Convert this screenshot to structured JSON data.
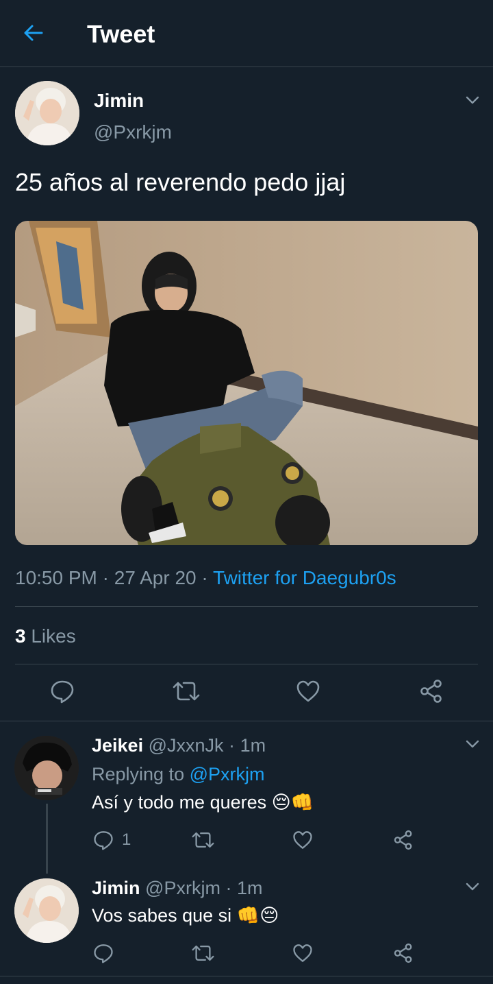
{
  "header": {
    "title": "Tweet"
  },
  "tweet": {
    "author_name": "Jimin",
    "author_handle": "@Pxrkjm",
    "text": "25 años al reverendo pedo jjaj",
    "time": "10:50 PM",
    "sep1": "·",
    "date": "27 Apr 20",
    "sep2": "·",
    "source": "Twitter for Daegubr0s",
    "likes_count": "3",
    "likes_label": "Likes"
  },
  "replies": [
    {
      "author_name": "Jeikei",
      "author_handle": "@JxxnJk",
      "dot": "·",
      "time": "1m",
      "replying_prefix": "Replying to",
      "replying_handle": "@Pxrkjm",
      "text": "Así y todo me queres 😔👊",
      "reply_count": "1"
    },
    {
      "author_name": "Jimin",
      "author_handle": "@Pxrkjm",
      "dot": "·",
      "time": "1m",
      "text": "Vos sabes que si 👊😔"
    }
  ],
  "colors": {
    "background": "#15202b",
    "accent": "#1da1f2",
    "muted": "#8899a6",
    "divider": "#38444d"
  },
  "icons": [
    "back-arrow-icon",
    "chevron-down-icon",
    "reply-icon",
    "retweet-icon",
    "like-icon",
    "share-icon"
  ]
}
